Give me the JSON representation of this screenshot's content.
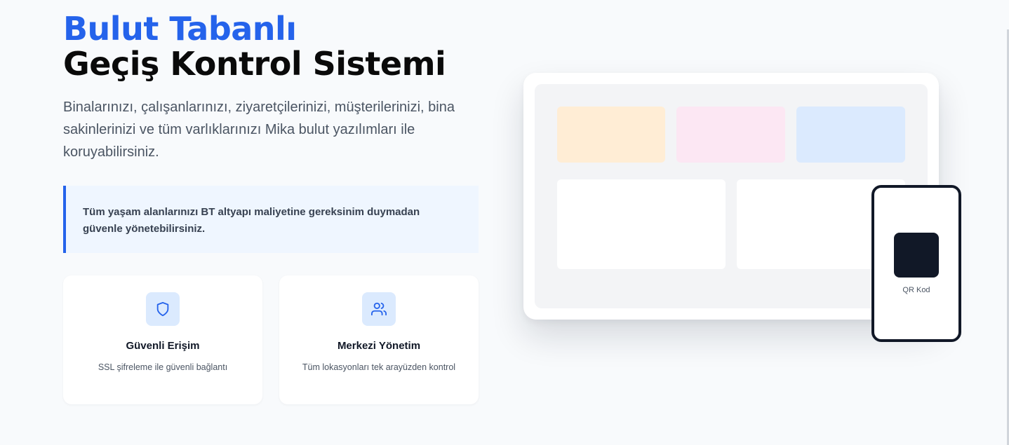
{
  "hero": {
    "title_line1": "Bulut Tabanlı",
    "title_line2": "Geçiş Kontrol Sistemi",
    "description": "Binalarınızı, çalışanlarınızı, ziyaretçilerinizi, müşterilerinizi, bina sakinlerinizi ve tüm varlıklarınızı Mika bulut yazılımları ile koruyabilirsiniz."
  },
  "callout": {
    "text": "Tüm yaşam alanlarınızı BT altyapı maliyetine gereksinim duymadan güvenle yönetebilirsiniz."
  },
  "features": [
    {
      "icon": "shield-icon",
      "title": "Güvenli Erişim",
      "description": "SSL şifreleme ile güvenli bağlantı"
    },
    {
      "icon": "users-icon",
      "title": "Merkezi Yönetim",
      "description": "Tüm lokasyonları tek arayüzden kontrol"
    }
  ],
  "illustration": {
    "qr_label": "QR Kod",
    "tile_colors": [
      "#ffedd5",
      "#fce7f3",
      "#dbeafe"
    ]
  },
  "colors": {
    "accent": "#2563eb",
    "dark": "#111827",
    "background": "#f8fafc"
  }
}
